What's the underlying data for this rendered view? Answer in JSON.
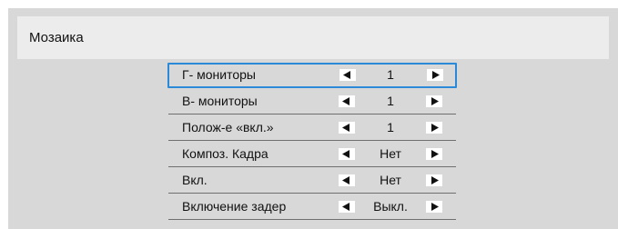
{
  "window": {
    "title": "Мозаика"
  },
  "menu": {
    "items": [
      {
        "label": "Г- мониторы",
        "value": "1",
        "selected": true
      },
      {
        "label": "В- мониторы",
        "value": "1",
        "selected": false
      },
      {
        "label": "Полож-е «вкл.»",
        "value": "1",
        "selected": false
      },
      {
        "label": "Композ. Кадра",
        "value": "Нет",
        "selected": false
      },
      {
        "label": "Вкл.",
        "value": "Нет",
        "selected": false
      },
      {
        "label": "Включение задер",
        "value": "Выкл.",
        "selected": false
      }
    ]
  },
  "icons": {
    "decrease": "left-arrow-icon",
    "increase": "right-arrow-icon"
  },
  "colors": {
    "background": "#d8d8d8",
    "title_bar": "#ececec",
    "selection": "#2b8ad8",
    "divider": "#6f6f6f"
  }
}
